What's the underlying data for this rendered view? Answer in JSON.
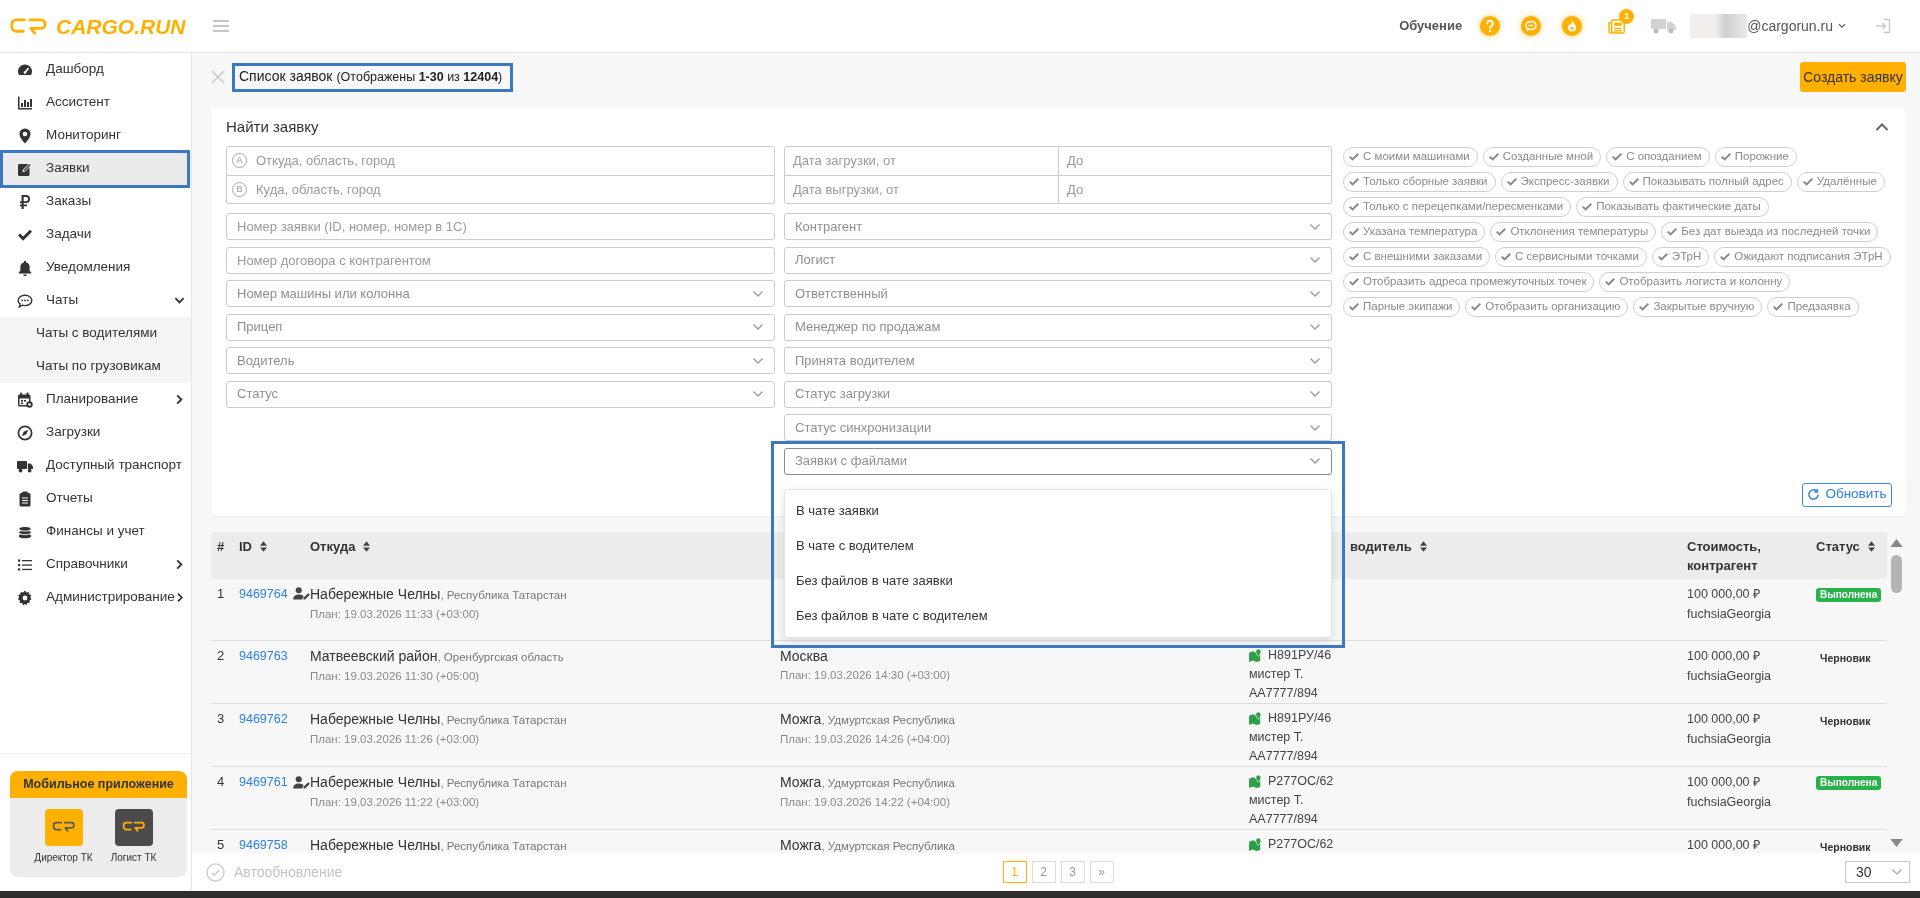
{
  "header": {
    "logo_text": "CARGO.RUN",
    "training_label": "Обучение",
    "news_badge": "1",
    "user_email": "@cargorun.ru"
  },
  "sidebar": {
    "items": [
      {
        "label": "Дашборд",
        "kind": "link",
        "selected": false,
        "highlighted": false
      },
      {
        "label": "Ассистент",
        "kind": "link",
        "selected": false,
        "highlighted": false
      },
      {
        "label": "Мониторинг",
        "kind": "link",
        "selected": false,
        "highlighted": false
      },
      {
        "label": "Заявки",
        "kind": "link",
        "selected": true,
        "highlighted": true
      },
      {
        "label": "Заказы",
        "kind": "link",
        "selected": false,
        "highlighted": false
      },
      {
        "label": "Задачи",
        "kind": "link",
        "selected": false,
        "highlighted": false
      },
      {
        "label": "Уведомления",
        "kind": "link",
        "selected": false,
        "highlighted": false
      },
      {
        "label": "Чаты",
        "kind": "group",
        "expanded": true,
        "selected": false,
        "highlighted": false,
        "children": [
          {
            "label": "Чаты с водителями",
            "selected": false
          },
          {
            "label": "Чаты по грузовикам",
            "selected": false
          }
        ]
      },
      {
        "label": "Планирование",
        "kind": "group",
        "expanded": false,
        "selected": false,
        "highlighted": false
      },
      {
        "label": "Загрузки",
        "kind": "link",
        "selected": false,
        "highlighted": false
      },
      {
        "label": "Доступный транспорт",
        "kind": "link",
        "selected": false,
        "highlighted": false
      },
      {
        "label": "Отчеты",
        "kind": "link",
        "selected": false,
        "highlighted": false
      },
      {
        "label": "Финансы и учет",
        "kind": "link",
        "selected": false,
        "highlighted": false
      },
      {
        "label": "Справочники",
        "kind": "group",
        "expanded": false,
        "selected": false,
        "highlighted": false
      },
      {
        "label": "Администрирование",
        "kind": "group",
        "expanded": false,
        "selected": false,
        "highlighted": false
      }
    ],
    "mobile_app": {
      "title": "Мобильное приложение",
      "apps": [
        {
          "label": "Директор ТК",
          "kind": "director"
        },
        {
          "label": "Логист ТК",
          "kind": "logist"
        }
      ]
    }
  },
  "page": {
    "title": "Список заявок",
    "record_count": "(Отображены **1-30** из **12404**)",
    "highlighted": true,
    "create_button": "Создать заявку"
  },
  "search_panel": {
    "title": "Найти заявку",
    "expanded": true,
    "route_fields": [
      {
        "marker": "A",
        "placeholder": "Откуда, область, город"
      },
      {
        "marker": "B",
        "placeholder": "Куда, область, город"
      }
    ],
    "left_fields": [
      {
        "kind": "text",
        "placeholder": "Номер заявки (ID, номер, номер в 1С)"
      },
      {
        "kind": "text",
        "placeholder": "Номер договора с контрагентом"
      },
      {
        "kind": "select",
        "placeholder": "Номер машины или колонна",
        "expanded": false
      },
      {
        "kind": "select",
        "placeholder": "Прицеп",
        "expanded": false
      },
      {
        "kind": "select",
        "placeholder": "Водитель",
        "expanded": false
      },
      {
        "kind": "select",
        "placeholder": "Статус",
        "expanded": false
      }
    ],
    "date_ranges": [
      {
        "from_placeholder": "Дата загрузки, от",
        "to_placeholder": "До"
      },
      {
        "from_placeholder": "Дата выгрузки, от",
        "to_placeholder": "До"
      }
    ],
    "right_fields": [
      {
        "kind": "select",
        "placeholder": "Контрагент",
        "expanded": false
      },
      {
        "kind": "select",
        "placeholder": "Логист",
        "expanded": false
      },
      {
        "kind": "select",
        "placeholder": "Ответственный",
        "expanded": false
      },
      {
        "kind": "select",
        "placeholder": "Менеджер по продажам",
        "expanded": false
      },
      {
        "kind": "select",
        "placeholder": "Принята водителем",
        "expanded": false
      },
      {
        "kind": "select",
        "placeholder": "Статус загрузки",
        "expanded": false
      },
      {
        "kind": "select",
        "placeholder": "Статус синхронизации",
        "expanded": false
      },
      {
        "kind": "select",
        "placeholder": "Заявки с файлами",
        "expanded": true,
        "highlighted": true,
        "options": [
          "В чате заявки",
          "В чате с водителем",
          "Без файлов в чате заявки",
          "Без файлов в чате с водителем"
        ]
      }
    ],
    "toggle_rows": [
      [
        {
          "label": "С моими машинами",
          "checked": false
        },
        {
          "label": "Созданные мной",
          "checked": false
        },
        {
          "label": "С опозданием",
          "checked": false
        },
        {
          "label": "Порожние",
          "checked": false
        }
      ],
      [
        {
          "label": "Только сборные заявки",
          "checked": false
        },
        {
          "label": "Экспресс-заявки",
          "checked": false
        },
        {
          "label": "Показывать полный адрес",
          "checked": false
        },
        {
          "label": "Удалённые",
          "checked": false
        }
      ],
      [
        {
          "label": "Только с перецепками/пересменками",
          "checked": false
        },
        {
          "label": "Показывать фактические даты",
          "checked": false
        }
      ],
      [
        {
          "label": "Указана температура",
          "checked": false
        },
        {
          "label": "Отклонения температуры",
          "checked": false
        },
        {
          "label": "Без дат выезда из последней точки",
          "checked": false
        }
      ],
      [
        {
          "label": "С внешними заказами",
          "checked": false
        },
        {
          "label": "С сервисными точками",
          "checked": false
        },
        {
          "label": "ЭТрН",
          "checked": false
        },
        {
          "label": "Ожидают подписания ЭТрН",
          "checked": false
        }
      ],
      [
        {
          "label": "Отобразить адреса промежуточных точек",
          "checked": false
        },
        {
          "label": "Отобразить логиста и колонну",
          "checked": false
        }
      ],
      [
        {
          "label": "Парные экипажи",
          "checked": false
        },
        {
          "label": "Отобразить организацию",
          "checked": false
        },
        {
          "label": "Закрытые вручную",
          "checked": false
        },
        {
          "label": "Предзаявка",
          "checked": false
        }
      ]
    ],
    "refresh_button": "Обновить"
  },
  "table": {
    "columns": [
      {
        "kind": "num",
        "label": "#",
        "sortable": false
      },
      {
        "kind": "id",
        "label": "ID",
        "sortable": true
      },
      {
        "kind": "from",
        "label": "Откуда",
        "sortable": true
      },
      {
        "kind": "to"
      },
      {
        "kind": "transport",
        "label": "водитель",
        "sortable": true
      },
      {
        "kind": "cost",
        "label": "Стоимость, контрагент",
        "sortable": false
      },
      {
        "kind": "status",
        "label": "Статус",
        "sortable": true
      }
    ],
    "rows": [
      {
        "number": "1",
        "id": "9469764",
        "user_mark": true,
        "from": {
          "city": "Набережные Челны",
          "region": ", Республика Татарстан",
          "plan": "План: 19.03.2026 11:33 (+03:00)"
        },
        "cost": {
          "amount": "100 000,00 ₽",
          "counterparty": "fuchsiaGeorgia"
        },
        "status": {
          "label": "Выполнена",
          "kind": "done"
        }
      },
      {
        "number": "2",
        "id": "9469763",
        "user_mark": false,
        "from": {
          "city": "Матвеевский район",
          "region": ", Оренбургская область",
          "plan": "План: 19.03.2026 11:30 (+05:00)"
        },
        "to": {
          "city": "Москва",
          "plan": "План: 19.03.2026 14:30 (+03:00)"
        },
        "transport": {
          "plate": "Н891РУ/46",
          "driver": "мистер Т.",
          "second_plate": "АА7777/894"
        },
        "cost": {
          "amount": "100 000,00 ₽",
          "counterparty": "fuchsiaGeorgia"
        },
        "status": {
          "label": "Черновик",
          "kind": "draft"
        }
      },
      {
        "number": "3",
        "id": "9469762",
        "user_mark": false,
        "from": {
          "city": "Набережные Челны",
          "region": ", Республика Татарстан",
          "plan": "План: 19.03.2026 11:26 (+03:00)"
        },
        "to": {
          "city": "Можга",
          "region": ", Удмуртская Республика",
          "plan": "План: 19.03.2026 14:26 (+04:00)"
        },
        "transport": {
          "plate": "Н891РУ/46",
          "driver": "мистер Т.",
          "second_plate": "АА7777/894"
        },
        "cost": {
          "amount": "100 000,00 ₽",
          "counterparty": "fuchsiaGeorgia"
        },
        "status": {
          "label": "Черновик",
          "kind": "draft"
        }
      },
      {
        "number": "4",
        "id": "9469761",
        "user_mark": true,
        "from": {
          "city": "Набережные Челны",
          "region": ", Республика Татарстан",
          "plan": "План: 19.03.2026 11:22 (+03:00)"
        },
        "to": {
          "city": "Можга",
          "region": ", Удмуртская Республика",
          "plan": "План: 19.03.2026 14:22 (+04:00)"
        },
        "transport": {
          "plate": "Р277ОС/62",
          "driver": "мистер Т.",
          "second_plate": "АА7777/894"
        },
        "cost": {
          "amount": "100 000,00 ₽",
          "counterparty": "fuchsiaGeorgia"
        },
        "status": {
          "label": "Выполнена",
          "kind": "done"
        }
      },
      {
        "number": "5",
        "id": "9469758",
        "user_mark": false,
        "from": {
          "city": "Набережные Челны",
          "region": ", Республика Татарстан"
        },
        "to": {
          "city": "Можга",
          "region": ", Удмуртская Республика"
        },
        "transport": {
          "plate": "Р277ОС/62"
        },
        "cost": {
          "amount": "100 000,00 ₽"
        },
        "status": {
          "label": "Черновик",
          "kind": "draft"
        }
      }
    ]
  },
  "footer": {
    "autorefresh": {
      "label": "Автообновление",
      "checked": false
    },
    "pages": [
      {
        "label": "1",
        "selected": true
      },
      {
        "label": "2",
        "selected": false
      },
      {
        "label": "3",
        "selected": false
      }
    ],
    "next_label": "»",
    "page_size": "30"
  }
}
